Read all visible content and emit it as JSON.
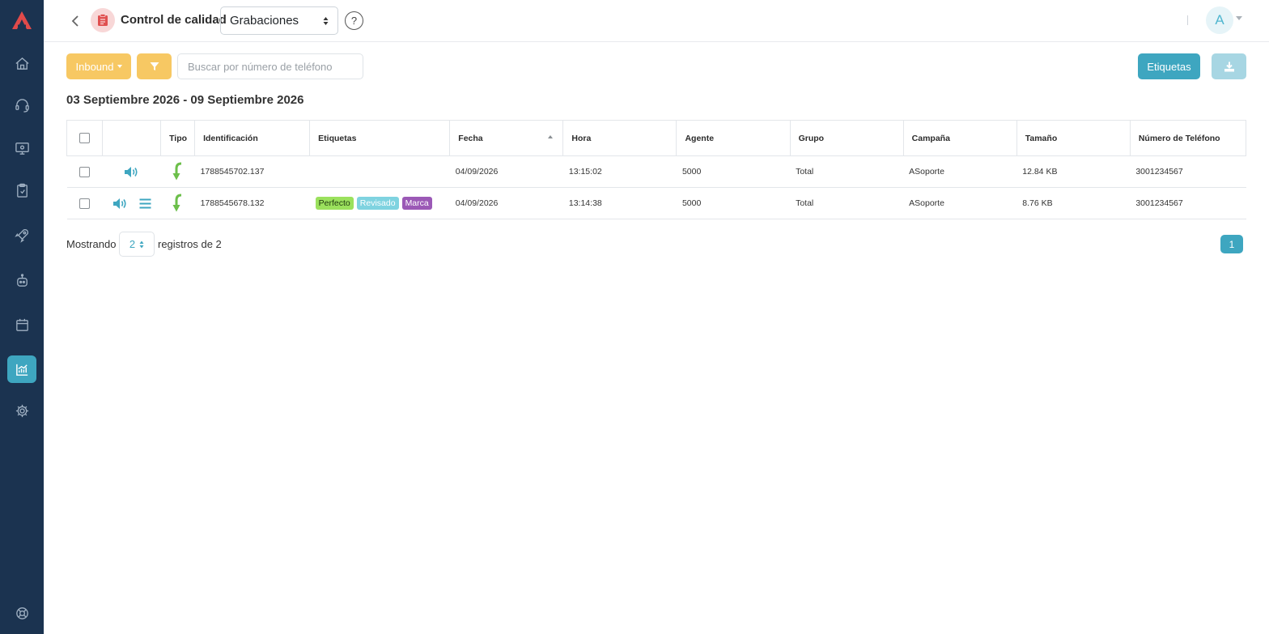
{
  "header": {
    "title": "Control de calidad",
    "module_select": "Grabaciones",
    "help": "?",
    "avatar_initial": "A"
  },
  "toolbar": {
    "direction_label": "Inbound",
    "search_placeholder": "Buscar por número de teléfono",
    "tags_label": "Etiquetas"
  },
  "date_range": "03 Septiembre 2026 - 09 Septiembre 2026",
  "table": {
    "columns": [
      "Tipo",
      "Identificación",
      "Etiquetas",
      "Fecha",
      "Hora",
      "Agente",
      "Grupo",
      "Campaña",
      "Tamaño",
      "Número de Teléfono"
    ],
    "rows": [
      {
        "id": "1788545702.137",
        "tags": [],
        "date": "04/09/2026",
        "time": "13:15:02",
        "agent": "5000",
        "group": "Total",
        "campaign": "ASoporte",
        "size": "12.84 KB",
        "phone": "3001234567"
      },
      {
        "id": "1788545678.132",
        "tags": [
          "Perfecto",
          "Revisado",
          "Marca"
        ],
        "date": "04/09/2026",
        "time": "13:14:38",
        "agent": "5000",
        "group": "Total",
        "campaign": "ASoporte",
        "size": "8.76 KB",
        "phone": "3001234567"
      }
    ]
  },
  "footer": {
    "showing_prefix": "Mostrando",
    "page_size": "2",
    "showing_suffix": "registros de 2",
    "current_page": "1"
  },
  "colors": {
    "sidebar": "#1b3350",
    "accent": "#3ea6c0",
    "warning": "#f7c863",
    "tag_perfecto": "#9be15d",
    "tag_revisado": "#7fd3e0",
    "tag_marca": "#9b59b6"
  }
}
